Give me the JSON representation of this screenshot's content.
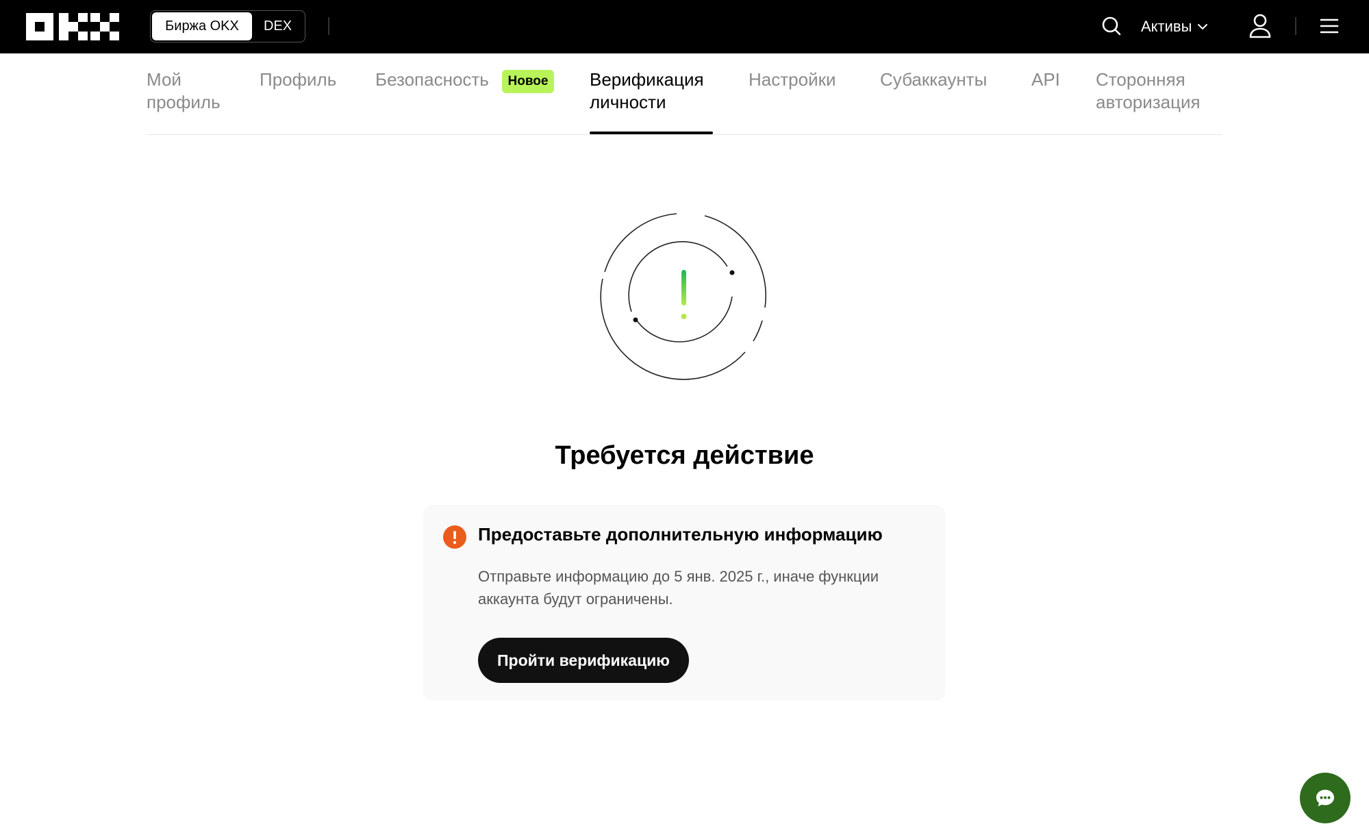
{
  "header": {
    "logo_name": "OKX",
    "switch": {
      "active_label": "Биржа OKX",
      "inactive_label": "DEX"
    },
    "assets_label": "Активы",
    "icons": [
      "search-icon",
      "chevron-down-icon",
      "user-icon",
      "menu-icon"
    ]
  },
  "tabs": {
    "items": [
      {
        "label": "Мой\nпрофиль"
      },
      {
        "label": "Профиль"
      },
      {
        "label": "Безопасность"
      },
      {
        "label": "Верификация\nличности"
      },
      {
        "label": "Настройки"
      },
      {
        "label": "Субаккаунты"
      },
      {
        "label": "API"
      },
      {
        "label": "Сторонняя\nавторизация"
      }
    ],
    "badge": "Новое",
    "active_index": 3
  },
  "main": {
    "title": "Требуется действие",
    "card": {
      "title": "Предоставьте дополнительную информацию",
      "text": "Отправьте информацию до 5 янв. 2025 г., иначе функции аккаунта будут ограничены.",
      "button": "Пройти верификацию"
    }
  },
  "colors": {
    "topbar": "#000000",
    "badge": "#b8f35a",
    "warning": "#ea5c1c",
    "chat_button": "#2e6b1d",
    "accent_green": "#7ddc3c"
  }
}
